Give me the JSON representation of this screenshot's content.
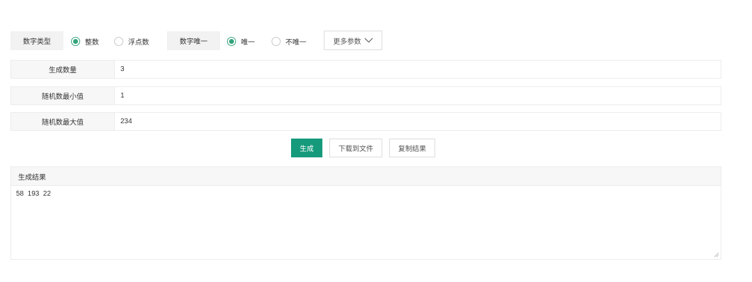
{
  "options": {
    "number_type_label": "数字类型",
    "integer_label": "整数",
    "float_label": "浮点数",
    "number_unique_label": "数字唯一",
    "unique_label": "唯一",
    "not_unique_label": "不唯一",
    "more_params_label": "更多参数",
    "selected_type": "整数",
    "selected_unique": "唯一"
  },
  "form": {
    "count_label": "生成数量",
    "count_value": "3",
    "min_label": "随机数最小值",
    "min_value": "1",
    "max_label": "随机数最大值",
    "max_value": "234"
  },
  "actions": {
    "generate_label": "生成",
    "download_label": "下载到文件",
    "copy_label": "复制结果"
  },
  "result": {
    "title": "生成结果",
    "value": "58  193  22"
  },
  "colors": {
    "accent": "#159a7c",
    "radio_checked": "#34a37a"
  }
}
